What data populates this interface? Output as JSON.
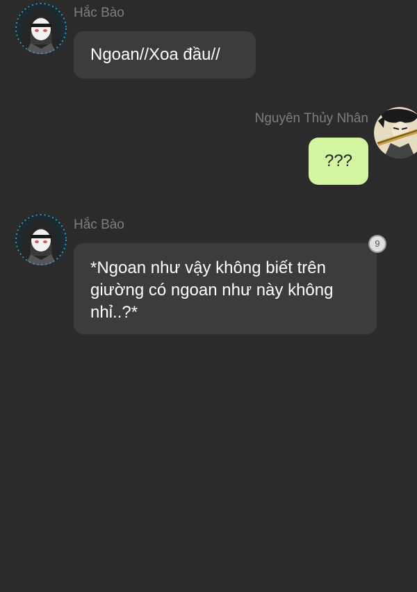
{
  "messages": [
    {
      "sender": "Hắc Bào",
      "side": "received",
      "text": "Ngoan//Xoa đầu//",
      "avatar_icon": "hooded-character-avatar-icon"
    },
    {
      "sender": "Nguyên Thủy Nhân",
      "side": "sent",
      "text": "???",
      "avatar_icon": "sword-character-avatar-icon"
    },
    {
      "sender": "Hắc Bào",
      "side": "received",
      "text": "*Ngoan như vậy không biết trên giường có ngoan như này không nhỉ..?*",
      "badge": "9",
      "avatar_icon": "hooded-character-avatar-icon"
    }
  ],
  "colors": {
    "background": "#2b2b2b",
    "received_bubble": "#3c3c3c",
    "sent_bubble": "#d3f5a2",
    "name_text": "#7e7e7e"
  }
}
